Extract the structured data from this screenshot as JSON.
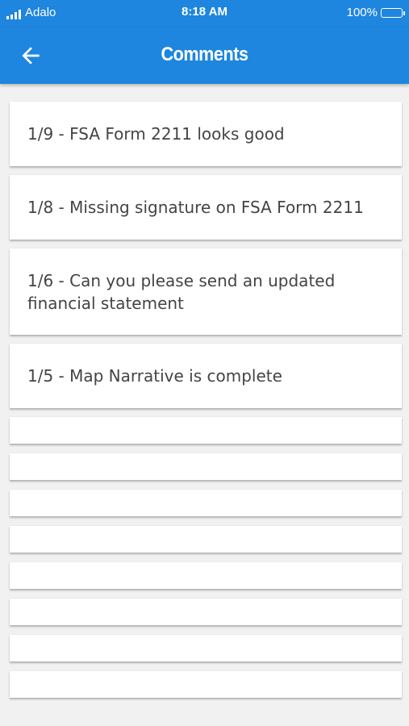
{
  "status_bar": {
    "carrier": "Adalo",
    "time": "8:18 AM",
    "battery": "100%"
  },
  "header": {
    "title": "Comments",
    "back_icon": "arrow-left-icon"
  },
  "colors": {
    "primary": "#1e86de",
    "background": "#f1f1f1",
    "card": "#ffffff",
    "text": "#444444"
  },
  "comments": [
    "1/9 - FSA Form 2211 looks good",
    "1/8 - Missing signature on FSA Form 2211",
    "1/6 - Can you please send an updated financial statement",
    "1/5 - Map Narrative is complete"
  ]
}
